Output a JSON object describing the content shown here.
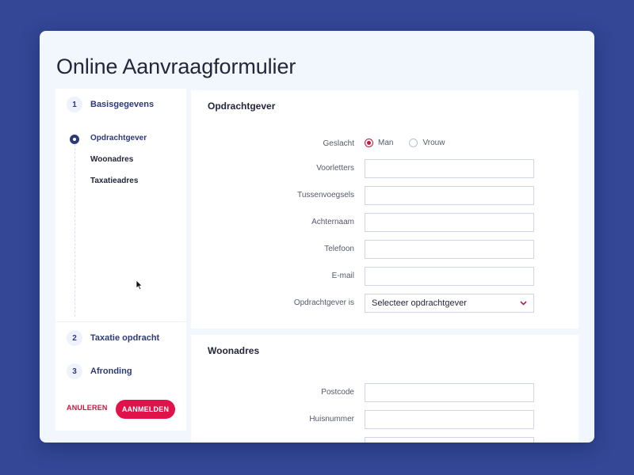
{
  "title": "Online Aanvraagformulier",
  "sidebar": {
    "steps": [
      {
        "num": "1",
        "label": "Basisgegevens"
      },
      {
        "num": "2",
        "label": "Taxatie opdracht"
      },
      {
        "num": "3",
        "label": "Afronding"
      }
    ],
    "sub_items": [
      "Opdrachtgever",
      "Woonadres",
      "Taxatieadres"
    ],
    "cancel_label": "ANULEREN",
    "submit_label": "AANMELDEN"
  },
  "opdrachtgever": {
    "title": "Opdrachtgever",
    "gender_label": "Geslacht",
    "gender_options": [
      "Man",
      "Vrouw"
    ],
    "gender_selected": "Man",
    "fields": [
      {
        "label": "Voorletters",
        "value": ""
      },
      {
        "label": "Tussenvoegsels",
        "value": ""
      },
      {
        "label": "Achternaam",
        "value": ""
      },
      {
        "label": "Telefoon",
        "value": ""
      },
      {
        "label": "E-mail",
        "value": ""
      }
    ],
    "select_label": "Opdrachtgever is",
    "select_value": "Selecteer opdrachtgever"
  },
  "woonadres": {
    "title": "Woonadres",
    "fields": [
      {
        "label": "Postcode",
        "value": ""
      },
      {
        "label": "Huisnummer",
        "value": ""
      }
    ]
  },
  "colors": {
    "background": "#334796",
    "accent": "#e0124a",
    "primary": "#2e3a78"
  }
}
